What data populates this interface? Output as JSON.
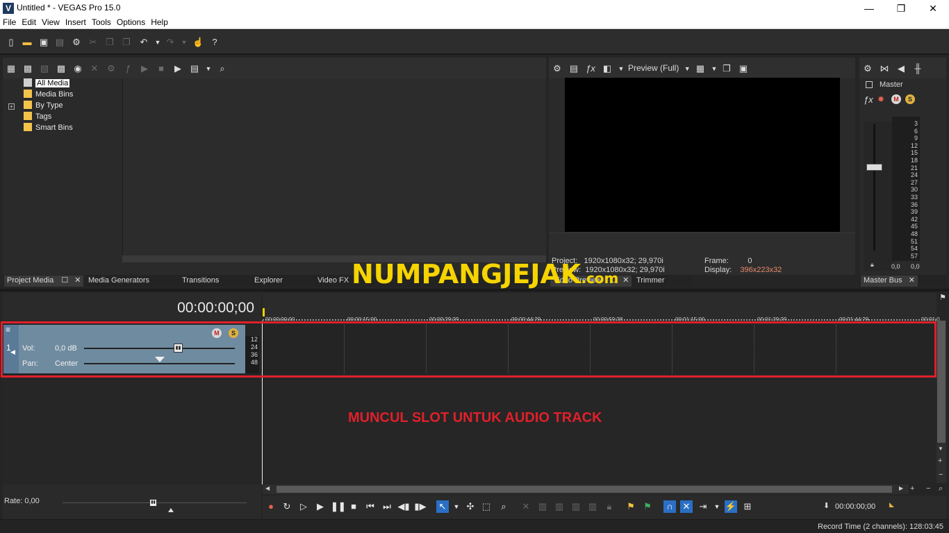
{
  "window": {
    "title": "Untitled * - VEGAS Pro 15.0",
    "app_icon": "V",
    "minimize": "—",
    "maximize": "❐",
    "close": "✕"
  },
  "menu": [
    "File",
    "Edit",
    "View",
    "Insert",
    "Tools",
    "Options",
    "Help"
  ],
  "media_tree": {
    "items": [
      {
        "label": "All Media"
      },
      {
        "label": "Media Bins"
      },
      {
        "label": "By Type"
      },
      {
        "label": "Tags"
      },
      {
        "label": "Smart Bins"
      }
    ]
  },
  "bottom_tabs": {
    "project_media": "Project Media",
    "media_generators": "Media Generators",
    "transitions": "Transitions",
    "explorer": "Explorer",
    "video_fx": "Video FX",
    "video_preview": "Video Preview",
    "trimmer": "Trimmer",
    "master_bus": "Master Bus"
  },
  "preview": {
    "quality": "Preview (Full)",
    "project_label": "Project:",
    "project_value": "1920x1080x32; 29,970i",
    "preview_label": "Preview:",
    "preview_value": "1920x1080x32; 29,970i",
    "frame_label": "Frame:",
    "frame_value": "0",
    "display_label": "Display:",
    "display_value": "396x223x32"
  },
  "master": {
    "label": "Master",
    "scale": [
      "3",
      "6",
      "9",
      "12",
      "15",
      "18",
      "21",
      "24",
      "27",
      "30",
      "33",
      "36",
      "39",
      "42",
      "45",
      "48",
      "51",
      "54",
      "57"
    ],
    "left_value": "0,0",
    "right_value": "0,0"
  },
  "timeline": {
    "timecode": "00:00:00;00",
    "ruler": [
      "00:00:00;00",
      "00:00:15;00",
      "00:00:29;29",
      "00:00:44;29",
      "00:00:59;28",
      "00:01:15;00",
      "00:01:29;29",
      "00:01:44;29",
      "00:01:0"
    ],
    "track": {
      "number": "1",
      "vol_label": "Vol:",
      "vol_value": "0,0 dB",
      "pan_label": "Pan:",
      "pan_value": "Center",
      "meter_labels": [
        "12",
        "24",
        "36",
        "48"
      ]
    }
  },
  "watermark": {
    "main": "NUMPANGJEJAK",
    "suffix": ".com"
  },
  "annotation": "MUNCUL SLOT UNTUK AUDIO TRACK",
  "footer": {
    "rate": "Rate: 0,00",
    "cursor_time": "00:00:00;00",
    "record_time": "Record Time (2 channels): 128:03:45"
  },
  "colors": {
    "accent_red": "#e0202a",
    "watermark_yellow": "#f5d400",
    "track_header": "#6f8ba0",
    "active_blue": "#2a6fc4"
  }
}
